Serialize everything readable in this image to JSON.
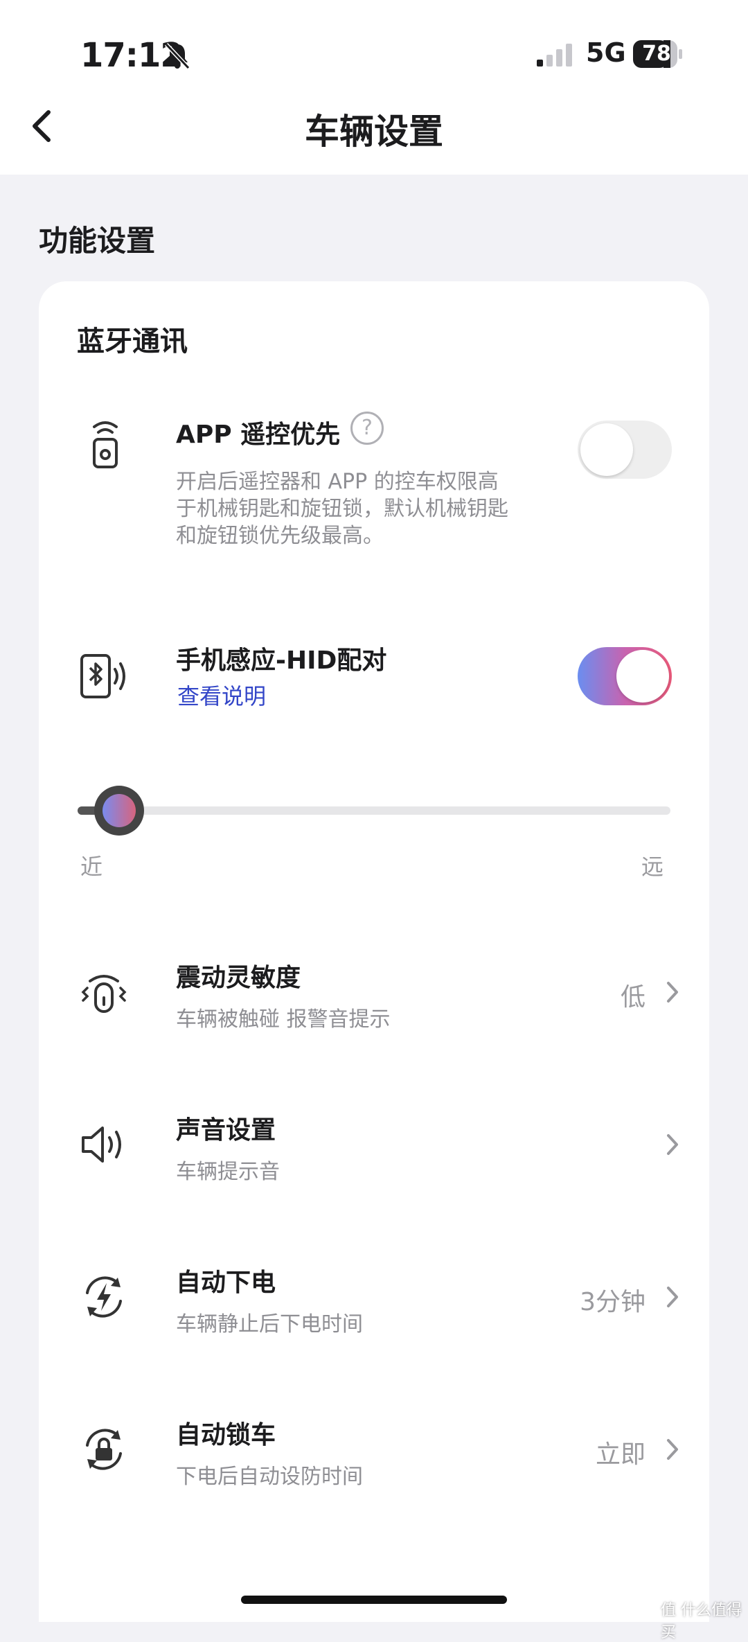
{
  "status": {
    "time": "17:12",
    "network": "5G",
    "battery": "78"
  },
  "header": {
    "title": "车辆设置",
    "back_icon": "chevron-left-icon"
  },
  "section": {
    "title": "功能设置"
  },
  "card": {
    "title": "蓝牙通讯",
    "app_remote": {
      "title": "APP 遥控优先",
      "help": "?",
      "desc": "开启后遥控器和 APP 的控车权限高于机械钥匙和旋钮锁，默认机械钥匙和旋钮锁优先级最高。",
      "enabled": false
    },
    "hid": {
      "title": "手机感应-HID配对",
      "link": "查看说明",
      "enabled": true
    },
    "sensing_range": {
      "min_label": "近",
      "max_label": "远",
      "value": 0.07
    },
    "items": [
      {
        "title": "震动灵敏度",
        "sub": "车辆被触碰 报警音提示",
        "value": "低"
      },
      {
        "title": "声音设置",
        "sub": "车辆提示音",
        "value": ""
      },
      {
        "title": "自动下电",
        "sub": "车辆静止后下电时间",
        "value": "3分钟"
      },
      {
        "title": "自动锁车",
        "sub": "下电后自动设防时间",
        "value": "立即"
      }
    ]
  },
  "watermark": "值 什么值得买",
  "colors": {
    "link": "#3346c8",
    "toggle_start": "#6a8ef0",
    "toggle_end": "#ea5a7a"
  }
}
